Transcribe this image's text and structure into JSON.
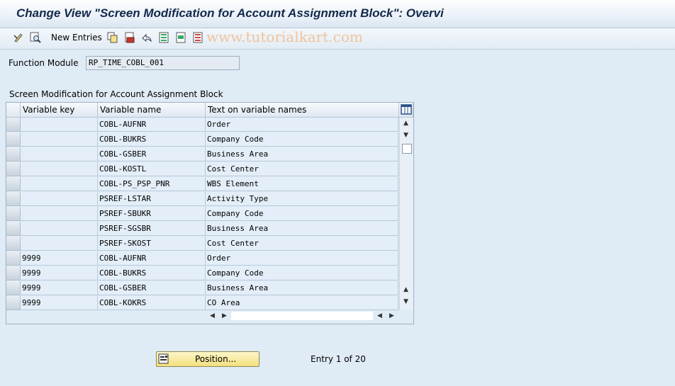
{
  "window": {
    "title": "Change View \"Screen Modification for Account Assignment Block\": Overvi"
  },
  "toolbar": {
    "new_entries_label": "New Entries",
    "icons": [
      "display-change-icon",
      "details-icon",
      "copy-icon",
      "delete-icon",
      "undo-icon",
      "select-all-icon",
      "select-block-icon",
      "deselect-all-icon"
    ]
  },
  "watermark": "www.tutorialkart.com",
  "function_module": {
    "label": "Function Module",
    "value": "RP_TIME_COBL_001"
  },
  "table": {
    "title": "Screen Modification for Account Assignment Block",
    "columns": [
      "Variable key",
      "Variable name",
      "Text on variable names"
    ],
    "rows": [
      {
        "key": "",
        "name": "COBL-AUFNR",
        "text": "Order"
      },
      {
        "key": "",
        "name": "COBL-BUKRS",
        "text": "Company Code"
      },
      {
        "key": "",
        "name": "COBL-GSBER",
        "text": "Business Area"
      },
      {
        "key": "",
        "name": "COBL-KOSTL",
        "text": "Cost Center"
      },
      {
        "key": "",
        "name": "COBL-PS_PSP_PNR",
        "text": "WBS Element"
      },
      {
        "key": "",
        "name": "PSREF-LSTAR",
        "text": "Activity Type"
      },
      {
        "key": "",
        "name": "PSREF-SBUKR",
        "text": "Company Code"
      },
      {
        "key": "",
        "name": "PSREF-SGSBR",
        "text": "Business Area"
      },
      {
        "key": "",
        "name": "PSREF-SKOST",
        "text": "Cost Center"
      },
      {
        "key": "9999",
        "name": "COBL-AUFNR",
        "text": "Order"
      },
      {
        "key": "9999",
        "name": "COBL-BUKRS",
        "text": "Company Code"
      },
      {
        "key": "9999",
        "name": "COBL-GSBER",
        "text": "Business Area"
      },
      {
        "key": "9999",
        "name": "COBL-KOKRS",
        "text": "CO Area"
      }
    ]
  },
  "footer": {
    "position_button_label": "Position...",
    "entry_text": "Entry 1 of 20"
  }
}
